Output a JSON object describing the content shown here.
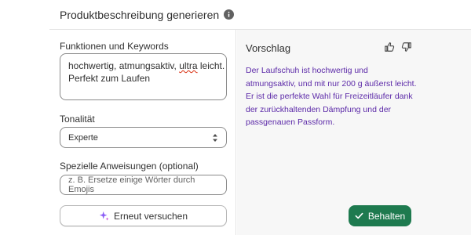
{
  "header": {
    "title": "Produktbeschreibung generieren",
    "info_icon": "info-icon"
  },
  "form": {
    "features_label": "Funktionen und Keywords",
    "features_value_line1_a": "hochwertig, atmungsaktiv, ",
    "features_value_line1_misspelled": "ultra",
    "features_value_line1_b": " leicht.",
    "features_value_line2": "Perfekt zum Laufen",
    "tone_label": "Tonalität",
    "tone_value": "Experte",
    "instructions_label": "Spezielle Anweisungen (optional)",
    "instructions_placeholder": "z. B. Ersetze einige Wörter durch Emojis",
    "retry_label": "Erneut versuchen"
  },
  "suggestion": {
    "title": "Vorschlag",
    "text": "Der Laufschuh ist hochwertig und atmungsaktiv, und mit nur 200 g äußerst leicht. Er ist die perfekte Wahl für Freizeitläufer dank der zurückhaltenden Dämpfung und der passgenauen Passform.",
    "keep_label": "Behalten"
  },
  "colors": {
    "accent_green": "#1e7a4f",
    "suggestion_text": "#5c2aa8",
    "sparkle": "#8a5cf6"
  }
}
